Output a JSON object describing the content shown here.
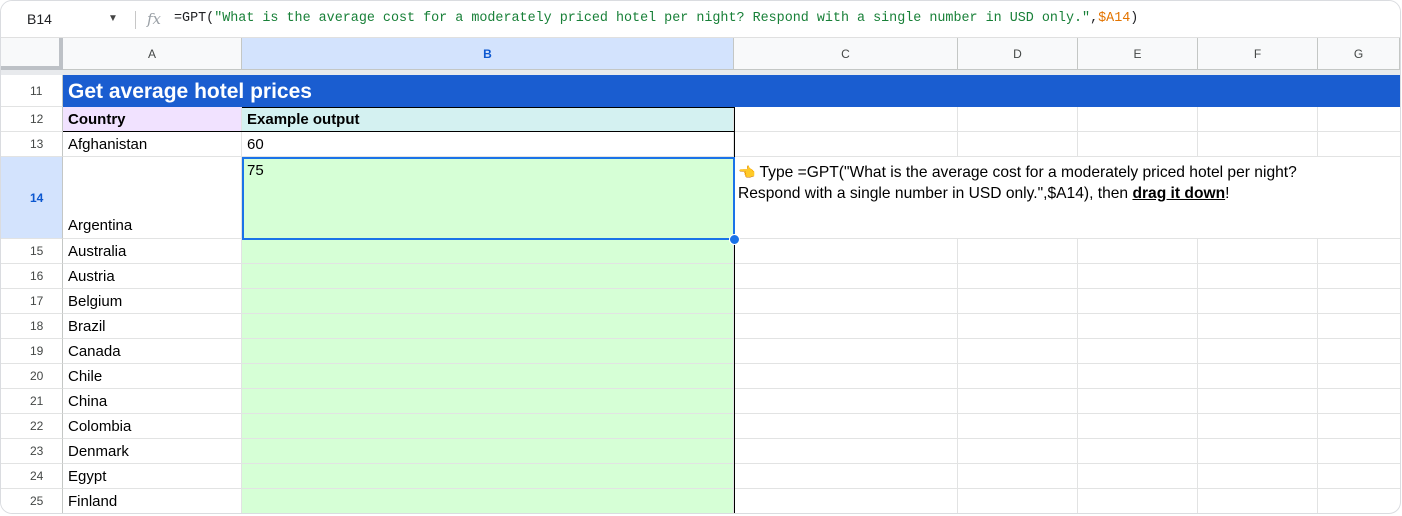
{
  "formula_bar": {
    "name_box": "B14",
    "fx": "fx",
    "formula_prefix": "=GPT(",
    "formula_string": "\"What is the average cost for a moderately priced hotel per night? Respond with a single number in USD only.\"",
    "formula_comma": ",",
    "formula_ref": "$A14",
    "formula_suffix": ")"
  },
  "columns": [
    "A",
    "B",
    "C",
    "D",
    "E",
    "F",
    "G"
  ],
  "selected_column": "B",
  "banner": {
    "row": "11",
    "title": "Get average hotel prices",
    "color": "#1a5dd0"
  },
  "header_row": {
    "row": "12",
    "country": "Country",
    "output": "Example output"
  },
  "rows": [
    {
      "row": "13",
      "country": "Afghanistan",
      "value": "60"
    },
    {
      "row": "14",
      "country": "Argentina",
      "value": "75"
    },
    {
      "row": "15",
      "country": "Australia",
      "value": ""
    },
    {
      "row": "16",
      "country": "Austria",
      "value": ""
    },
    {
      "row": "17",
      "country": "Belgium",
      "value": ""
    },
    {
      "row": "18",
      "country": "Brazil",
      "value": ""
    },
    {
      "row": "19",
      "country": "Canada",
      "value": ""
    },
    {
      "row": "20",
      "country": "Chile",
      "value": ""
    },
    {
      "row": "21",
      "country": "China",
      "value": ""
    },
    {
      "row": "22",
      "country": "Colombia",
      "value": ""
    },
    {
      "row": "23",
      "country": "Denmark",
      "value": ""
    },
    {
      "row": "24",
      "country": "Egypt",
      "value": ""
    },
    {
      "row": "25",
      "country": "Finland",
      "value": ""
    }
  ],
  "selected_cell": "B14",
  "instruction": {
    "icon": "pointing-hand-icon",
    "glyph": "👈",
    "line1": "Type =GPT(\"What is the average cost for a moderately priced hotel per night?",
    "line2_prefix": "Respond with a single number in USD only.\",$A14), then ",
    "line2_bold": "drag it down",
    "line2_suffix": "!"
  },
  "colors": {
    "country_header": "#f1e2ff",
    "output_header": "#d4f1f1",
    "output_fill": "#d6ffd6",
    "selection": "#1a73e8"
  }
}
